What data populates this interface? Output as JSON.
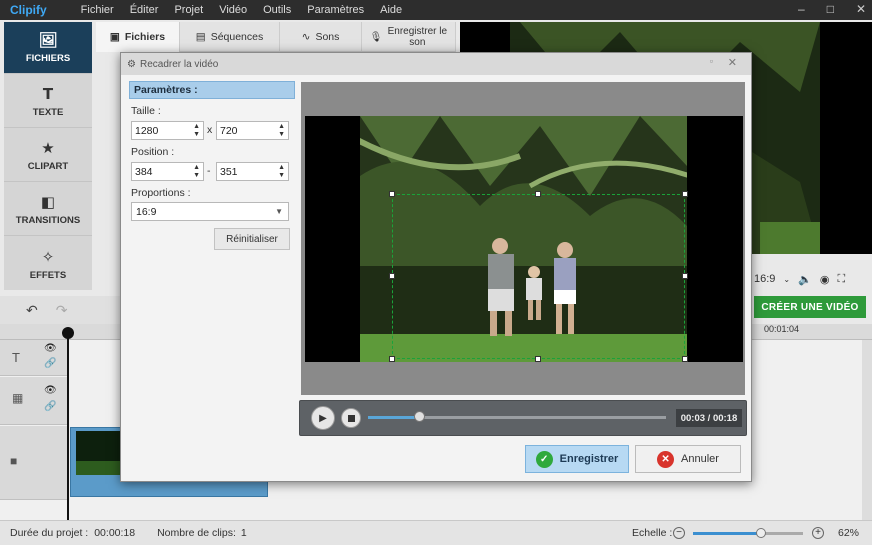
{
  "app": {
    "logo": "Clipify",
    "menu": [
      "Fichier",
      "Éditer",
      "Projet",
      "Vidéo",
      "Outils",
      "Paramètres",
      "Aide"
    ],
    "window_controls": [
      "–",
      "□",
      "✕"
    ]
  },
  "left_tools": [
    {
      "label": "FICHIERS",
      "icon": "image-icon"
    },
    {
      "label": "TEXTE",
      "icon": "text-icon"
    },
    {
      "label": "CLIPART",
      "icon": "star-icon"
    },
    {
      "label": "TRANSITIONS",
      "icon": "transitions-icon"
    },
    {
      "label": "EFFETS",
      "icon": "magic-wand-icon"
    }
  ],
  "tabs": [
    {
      "label": "Fichiers",
      "icon": "image-icon"
    },
    {
      "label": "Séquences",
      "icon": "film-icon"
    },
    {
      "label": "Sons",
      "icon": "waveform-icon"
    },
    {
      "label": "Enregistrer le son",
      "icon": "microphone-icon"
    }
  ],
  "preview": {
    "aspect_label": "16:9",
    "create_button": "CRÉER UNE VIDÉO",
    "timecode": "00:01:04"
  },
  "dialog": {
    "title": "Recadrer la vidéo",
    "params_header": "Paramètres :",
    "size_label": "Taille :",
    "width": "1280",
    "height": "720",
    "size_sep": "x",
    "position_label": "Position :",
    "pos_x": "384",
    "pos_y": "351",
    "pos_sep": "-",
    "proportions_label": "Proportions :",
    "proportions_value": "16:9",
    "reset_button": "Réinitialiser",
    "time_display": "00:03 / 00:18",
    "progress": 0.17,
    "save_button": "Enregistrer",
    "cancel_button": "Annuler"
  },
  "status": {
    "duration_label": "Durée du projet :",
    "duration_value": "00:00:18",
    "clips_label": "Nombre de clips:",
    "clips_value": "1",
    "zoom_label": "Echelle :",
    "zoom_value": "62%",
    "zoom_level": 0.62
  }
}
